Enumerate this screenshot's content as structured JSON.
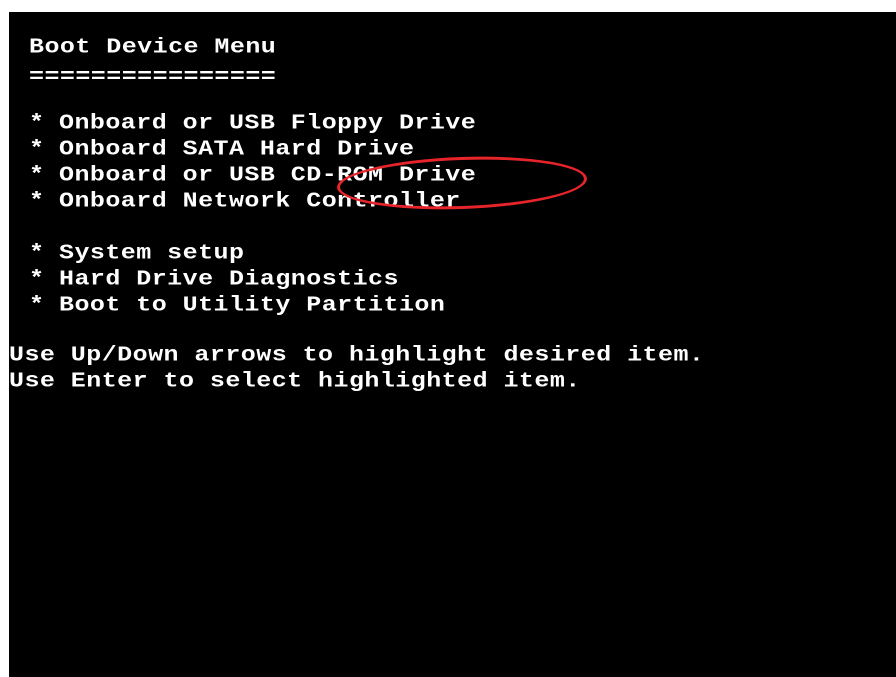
{
  "screen": {
    "title": "Boot Device Menu",
    "underline": "================",
    "bullet_symbol": "*",
    "devices": [
      {
        "label": "Onboard or USB Floppy Drive"
      },
      {
        "label": "Onboard SATA Hard Drive"
      },
      {
        "label": "Onboard or USB CD-ROM Drive"
      },
      {
        "label": "Onboard Network Controller"
      }
    ],
    "utilities": [
      {
        "label": "System setup"
      },
      {
        "label": "Hard Drive Diagnostics"
      },
      {
        "label": "Boot to Utility Partition"
      }
    ],
    "instructions": [
      "Use Up/Down arrows to highlight desired item.",
      "Use Enter to select highlighted item."
    ]
  },
  "annotation": {
    "highlight_color": "#e8242b",
    "highlighted_text": "CD-ROM Drive"
  },
  "colors": {
    "background": "#000000",
    "text": "#ffffff"
  }
}
